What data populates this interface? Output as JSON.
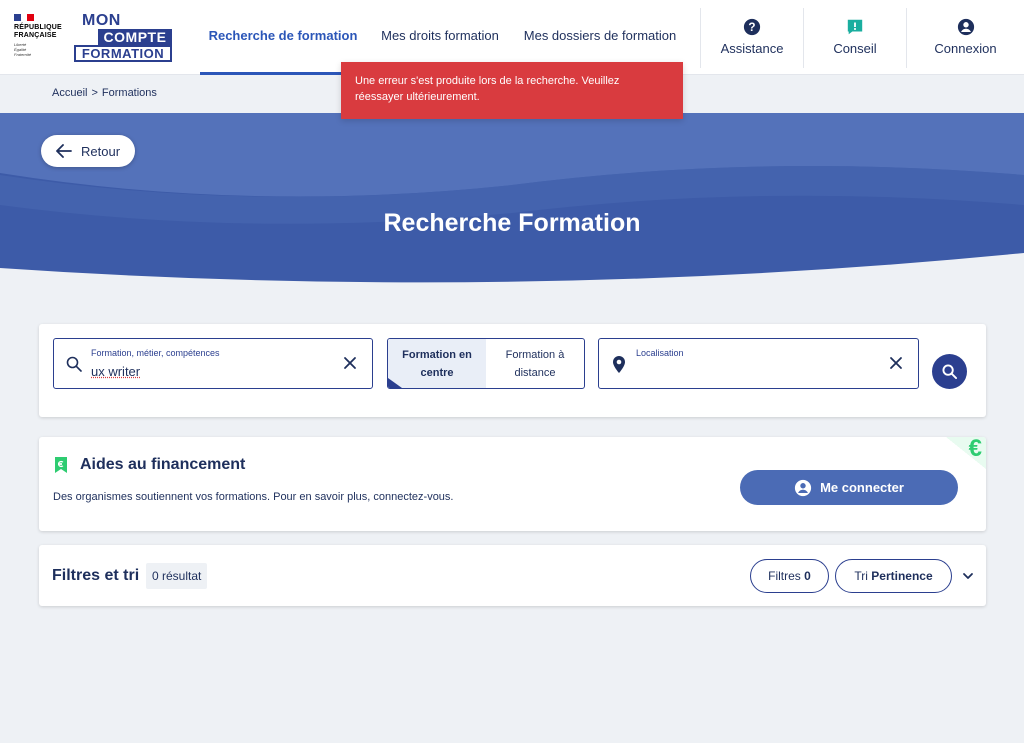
{
  "header": {
    "republic_lines": [
      "RÉPUBLIQUE",
      "FRANÇAISE"
    ],
    "republic_motto": [
      "Liberté",
      "Égalité",
      "Fraternité"
    ],
    "logo": {
      "line1": "MON",
      "line2": "COMPTE",
      "line3": "FORMATION"
    },
    "nav": [
      {
        "label": "Recherche de formation",
        "active": true
      },
      {
        "label": "Mes droits formation",
        "active": false
      },
      {
        "label": "Mes dossiers de formation",
        "active": false
      }
    ],
    "buttons": [
      {
        "label": "Assistance",
        "icon": "question-circle-icon"
      },
      {
        "label": "Conseil",
        "icon": "chat-alert-icon"
      },
      {
        "label": "Connexion",
        "icon": "user-circle-icon"
      }
    ]
  },
  "breadcrumb": {
    "home": "Accueil",
    "separator": ">",
    "current": "Formations"
  },
  "toast": {
    "message": "Une erreur s'est produite lors de la recherche. Veuillez réessayer ultérieurement."
  },
  "banner": {
    "back_label": "Retour",
    "title": "Recherche Formation"
  },
  "search": {
    "query_label": "Formation, métier, compétences",
    "query_value": "ux writer",
    "modes": [
      {
        "label": "Formation en centre",
        "selected": true
      },
      {
        "label": "Formation à distance",
        "selected": false
      }
    ],
    "location_label": "Localisation",
    "location_value": ""
  },
  "funding": {
    "title": "Aides au financement",
    "description": "Des organismes soutiennent vos formations. Pour en savoir plus, connectez-vous.",
    "connect_label": "Me connecter",
    "corner_symbol": "€"
  },
  "filters": {
    "title": "Filtres et tri",
    "result_count": "0 résultat",
    "filters_label": "Filtres",
    "filters_count": "0",
    "sort_label": "Tri",
    "sort_value": "Pertinence"
  },
  "colors": {
    "primary": "#2b3f8f",
    "active_nav": "#2b56b8",
    "error": "#d93b3f",
    "banner": "#3d5ba8",
    "accent_green": "#2ecc71"
  }
}
